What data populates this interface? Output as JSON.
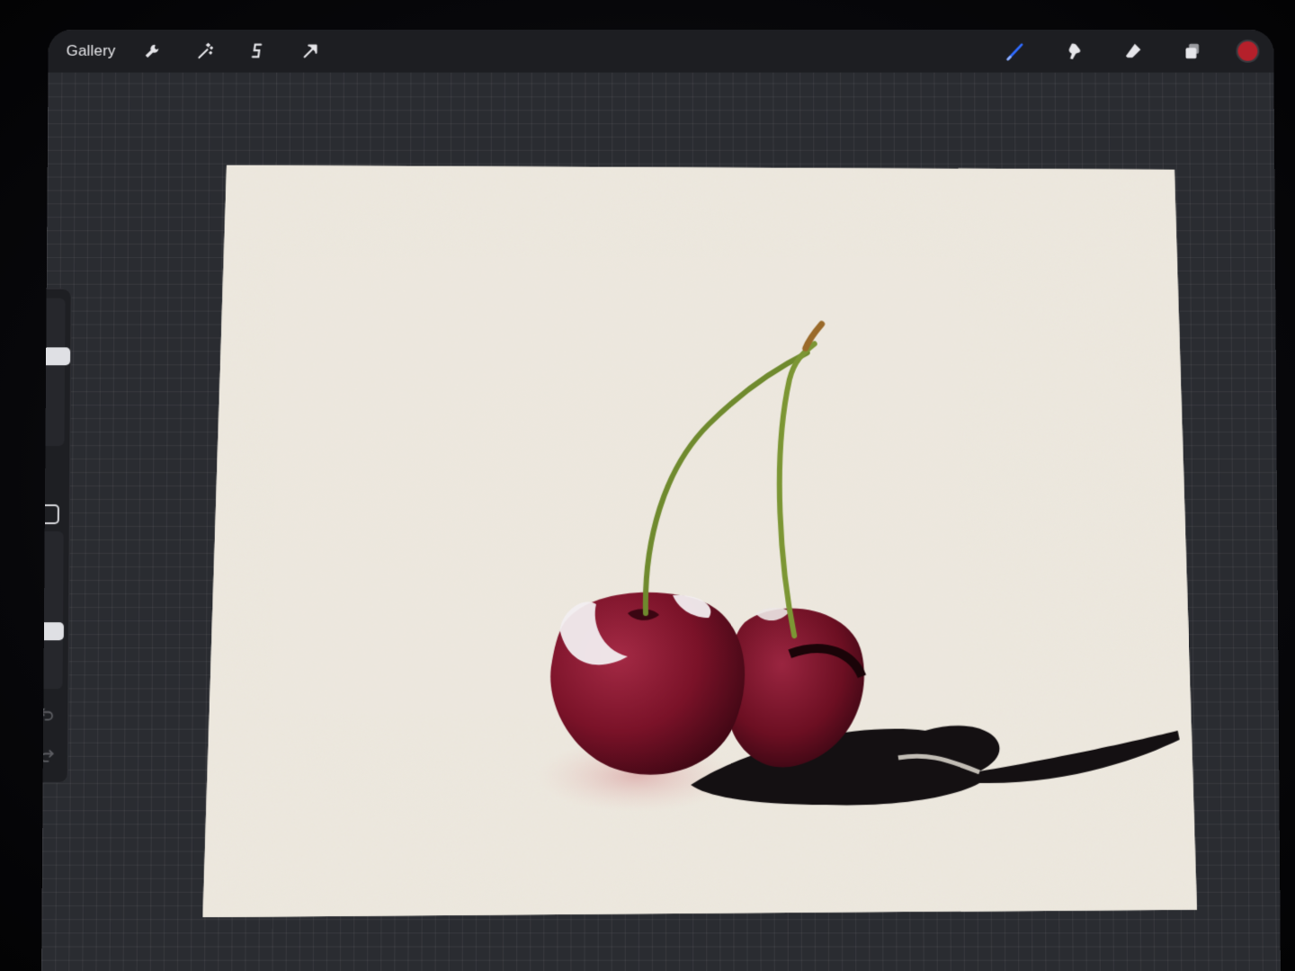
{
  "toolbar": {
    "gallery_label": "Gallery",
    "left_tools": [
      {
        "name": "actions-wrench-icon"
      },
      {
        "name": "adjustments-magic-wand-icon"
      },
      {
        "name": "selection-s-curve-icon"
      },
      {
        "name": "transform-arrow-icon"
      }
    ],
    "right_tools": [
      {
        "name": "brush-icon",
        "active": true
      },
      {
        "name": "smudge-icon"
      },
      {
        "name": "eraser-icon"
      },
      {
        "name": "layers-icon"
      }
    ],
    "current_color": "#b5202b",
    "accent_color": "#2f6bff"
  },
  "sidebar": {
    "brush_size_level": 0.62,
    "opacity_level": 0.35,
    "undo_icon": "undo-arrow-icon",
    "redo_icon": "redo-arrow-icon"
  },
  "canvas": {
    "paper_color": "#ece7dd",
    "cherry_color": "#7a1228",
    "stem_color": "#6f8a2e",
    "shadow_color": "#141012"
  }
}
